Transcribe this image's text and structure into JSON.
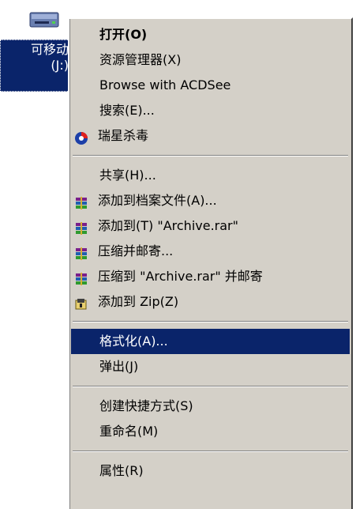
{
  "desktop_icon": {
    "label_line1": "可移动",
    "label_line2": "(J:)",
    "icon": "removable-drive-icon"
  },
  "context_menu": {
    "open": "打开(O)",
    "explorer": "资源管理器(X)",
    "browse_acdsee": "Browse with ACDSee",
    "search": "搜索(E)...",
    "rising_antivirus": "瑞星杀毒",
    "share": "共享(H)...",
    "add_to_archive": "添加到档案文件(A)...",
    "add_to_archive_rar": "添加到(T) \"Archive.rar\"",
    "compress_email": "压缩并邮寄...",
    "compress_rar_email": "压缩到 \"Archive.rar\" 并邮寄",
    "add_to_zip": "添加到 Zip(Z)",
    "format": "格式化(A)...",
    "eject": "弹出(J)",
    "create_shortcut": "创建快捷方式(S)",
    "rename": "重命名(M)",
    "properties": "属性(R)"
  },
  "colors": {
    "selection": "#0a246a",
    "menu_bg": "#d4d0c8"
  }
}
